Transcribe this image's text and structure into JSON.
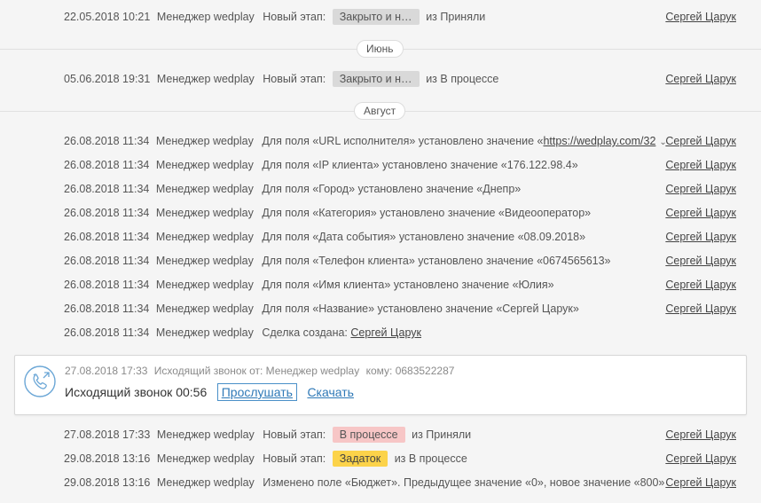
{
  "manager": "Менеджер wedplay",
  "author": "Сергей Царук",
  "top_events": [
    {
      "date": "22.05.2018 10:21",
      "text": "Новый этап:",
      "stage": "Закрыто и не р...",
      "from": "из Приняли"
    },
    {
      "date": "05.06.2018 19:31",
      "text": "Новый этап:",
      "stage": "Закрыто и не р...",
      "from": "из В процессе"
    }
  ],
  "months": {
    "june": "Июнь",
    "august": "Август"
  },
  "field_events": [
    {
      "date": "26.08.2018 11:34",
      "text": "Для поля «URL исполнителя» установлено значение «",
      "link": "https://wedplay.com/32"
    },
    {
      "date": "26.08.2018 11:34",
      "text": "Для поля «IP клиента» установлено значение «176.122.98.4»"
    },
    {
      "date": "26.08.2018 11:34",
      "text": "Для поля «Город» установлено значение «Днепр»"
    },
    {
      "date": "26.08.2018 11:34",
      "text": "Для поля «Категория» установлено значение «Видеооператор»"
    },
    {
      "date": "26.08.2018 11:34",
      "text": "Для поля «Дата события» установлено значение «08.09.2018»"
    },
    {
      "date": "26.08.2018 11:34",
      "text": "Для поля «Телефон клиента» установлено значение «0674565613»"
    },
    {
      "date": "26.08.2018 11:34",
      "text": "Для поля «Имя клиента» установлено значение «Юлия»"
    },
    {
      "date": "26.08.2018 11:34",
      "text": "Для поля «Название» установлено значение «Сергей Царук»"
    }
  ],
  "deal_created": {
    "date": "26.08.2018 11:34",
    "text": "Сделка создана:",
    "link": "Сергей Царук"
  },
  "call": {
    "date": "27.08.2018 17:33",
    "from_label": "Исходящий звонок от: Менеджер wedplay",
    "to_label": "кому: 0683522287",
    "title": "Исходящий звонок 00:56",
    "listen": "Прослушать",
    "download": "Скачать"
  },
  "bottom_events": [
    {
      "date": "27.08.2018 17:33",
      "text": "Новый этап:",
      "stage": "В процессе",
      "from": "из Приняли",
      "color": "#f7c6c6"
    },
    {
      "date": "29.08.2018 13:16",
      "text": "Новый этап:",
      "stage": "Задаток",
      "from": "из В процессе",
      "color": "#fcd34a"
    }
  ],
  "budget_event": {
    "date": "29.08.2018 13:16",
    "text": "Изменено поле «Бюджет». Предыдущее значение «0», новое значение «800»"
  }
}
